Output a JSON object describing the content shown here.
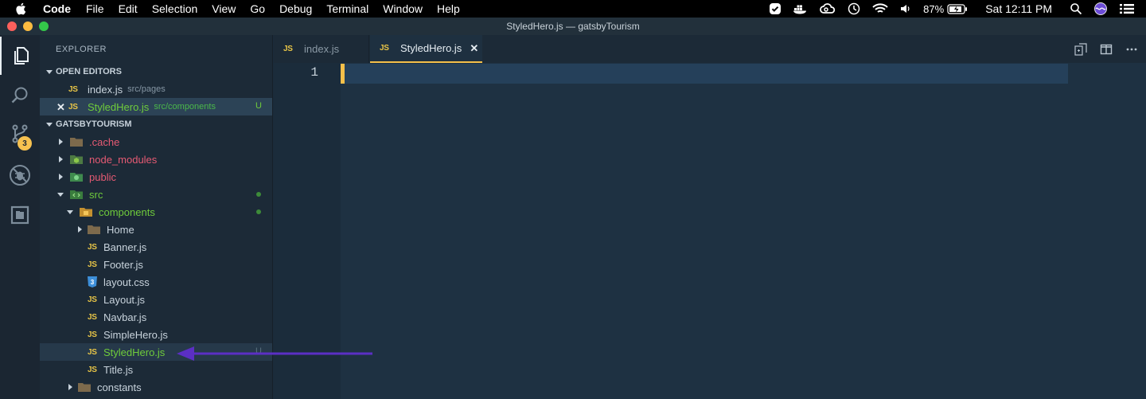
{
  "menubar": {
    "items": [
      "Code",
      "File",
      "Edit",
      "Selection",
      "View",
      "Go",
      "Debug",
      "Terminal",
      "Window",
      "Help"
    ],
    "battery": "87%",
    "clock": "Sat 12:11 PM"
  },
  "window": {
    "title": "StyledHero.js — gatsbyTourism"
  },
  "activity_bar": {
    "icons": [
      "files-icon",
      "search-icon",
      "source-control-icon",
      "debug-icon",
      "extensions-icon"
    ],
    "source_control_badge": "3"
  },
  "sidebar": {
    "title": "EXPLORER",
    "open_editors": {
      "header": "OPEN EDITORS",
      "items": [
        {
          "label": "index.js",
          "path": "src/pages"
        },
        {
          "label": "StyledHero.js",
          "path": "src/components",
          "status": "U"
        }
      ]
    },
    "project": {
      "header": "GATSBYTOURISM",
      "tree": [
        {
          "label": ".cache"
        },
        {
          "label": "node_modules"
        },
        {
          "label": "public"
        },
        {
          "label": "src"
        },
        {
          "label": "components"
        },
        {
          "label": "Home"
        },
        {
          "label": "Banner.js"
        },
        {
          "label": "Footer.js"
        },
        {
          "label": "layout.css"
        },
        {
          "label": "Layout.js"
        },
        {
          "label": "Navbar.js"
        },
        {
          "label": "SimpleHero.js"
        },
        {
          "label": "StyledHero.js",
          "status": "U"
        },
        {
          "label": "Title.js"
        },
        {
          "label": "constants"
        }
      ]
    }
  },
  "tabs": [
    {
      "label": "index.js",
      "icon": "JS"
    },
    {
      "label": "StyledHero.js",
      "icon": "JS"
    }
  ],
  "editor": {
    "line_numbers": [
      "1"
    ]
  },
  "colors": {
    "accent": "#f5c04a",
    "untracked_green": "#6fcc3b",
    "ignored_red": "#e65a73",
    "annotation_arrow": "#5b2fc4"
  }
}
